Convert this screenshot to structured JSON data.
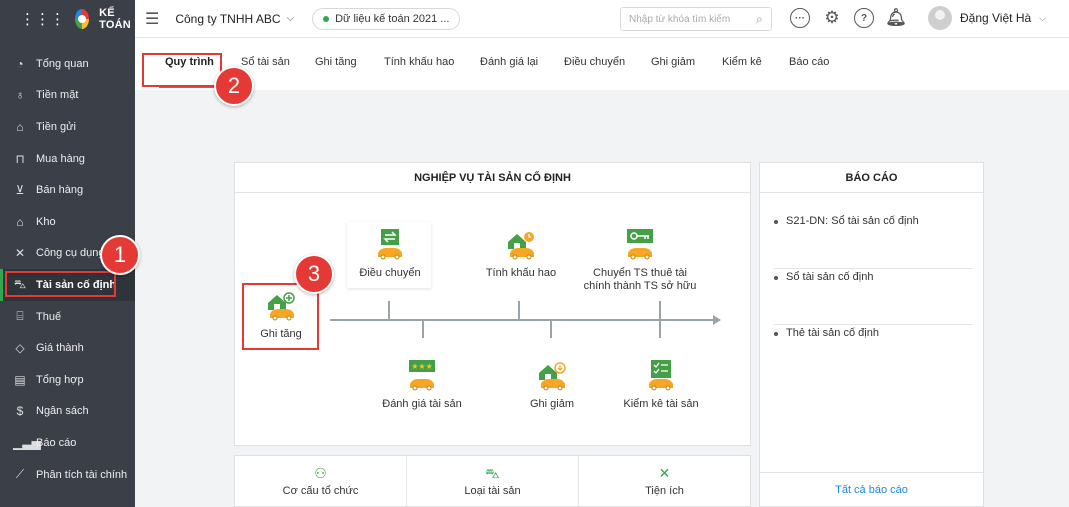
{
  "brand": {
    "name": "KẾ TOÁN"
  },
  "sidebar": {
    "items": [
      {
        "label": "Tổng quan",
        "icon": "dashboard-icon"
      },
      {
        "label": "Tiền mặt",
        "icon": "money-bag-icon"
      },
      {
        "label": "Tiền gửi",
        "icon": "bank-icon"
      },
      {
        "label": "Mua hàng",
        "icon": "shopping-bag-icon"
      },
      {
        "label": "Bán hàng",
        "icon": "cart-icon"
      },
      {
        "label": "Kho",
        "icon": "warehouse-icon"
      },
      {
        "label": "Công cụ dụng",
        "icon": "tools-icon"
      },
      {
        "label": "Tài sản cố định",
        "icon": "car-icon",
        "active": true
      },
      {
        "label": "Thuế",
        "icon": "tax-icon"
      },
      {
        "label": "Giá thành",
        "icon": "tag-icon"
      },
      {
        "label": "Tổng hợp",
        "icon": "document-icon"
      },
      {
        "label": "Ngân sách",
        "icon": "budget-icon"
      },
      {
        "label": "Báo cáo",
        "icon": "bar-chart-icon"
      },
      {
        "label": "Phân tích tài chính",
        "icon": "trend-icon"
      }
    ]
  },
  "header": {
    "company": "Công ty TNHH ABC",
    "data_label": "Dữ liệu kế toán 2021 ...",
    "search_placeholder": "Nhập từ khóa tìm kiếm",
    "user_name": "Đặng Việt Hà",
    "icons": [
      "more-icon",
      "settings-icon",
      "help-icon",
      "bell-icon"
    ]
  },
  "tabs": [
    "Quy trình",
    "Sổ tài sản",
    "Ghi tăng",
    "Tính khấu hao",
    "Đánh giá lại",
    "Điều chuyển",
    "Ghi giảm",
    "Kiểm kê",
    "Báo cáo"
  ],
  "process": {
    "title": "NGHIỆP VỤ TÀI SẢN CỐ ĐỊNH",
    "start": "Ghi tăng",
    "top_nodes": [
      "Điều chuyển",
      "Tính khấu hao",
      "Chuyển TS thuê tài chính thành TS sở hữu"
    ],
    "bottom_nodes": [
      "Đánh giá tài sản",
      "Ghi giảm",
      "Kiểm kê tài sản"
    ]
  },
  "bottom_bar": [
    "Cơ cấu tổ chức",
    "Loại tài sản",
    "Tiện ích"
  ],
  "report": {
    "title": "BÁO CÁO",
    "items": [
      "S21-DN: Sổ tài sản cố định",
      "Sổ tài sản cố định",
      "Thẻ tài sản cố định"
    ],
    "footer": "Tất cả báo cáo"
  },
  "annotations": [
    "1",
    "2",
    "3"
  ],
  "colors": {
    "accent": "#2fa84f",
    "sidebar": "#3b3f48",
    "annotation": "#e53935",
    "link": "#1e88e5"
  }
}
